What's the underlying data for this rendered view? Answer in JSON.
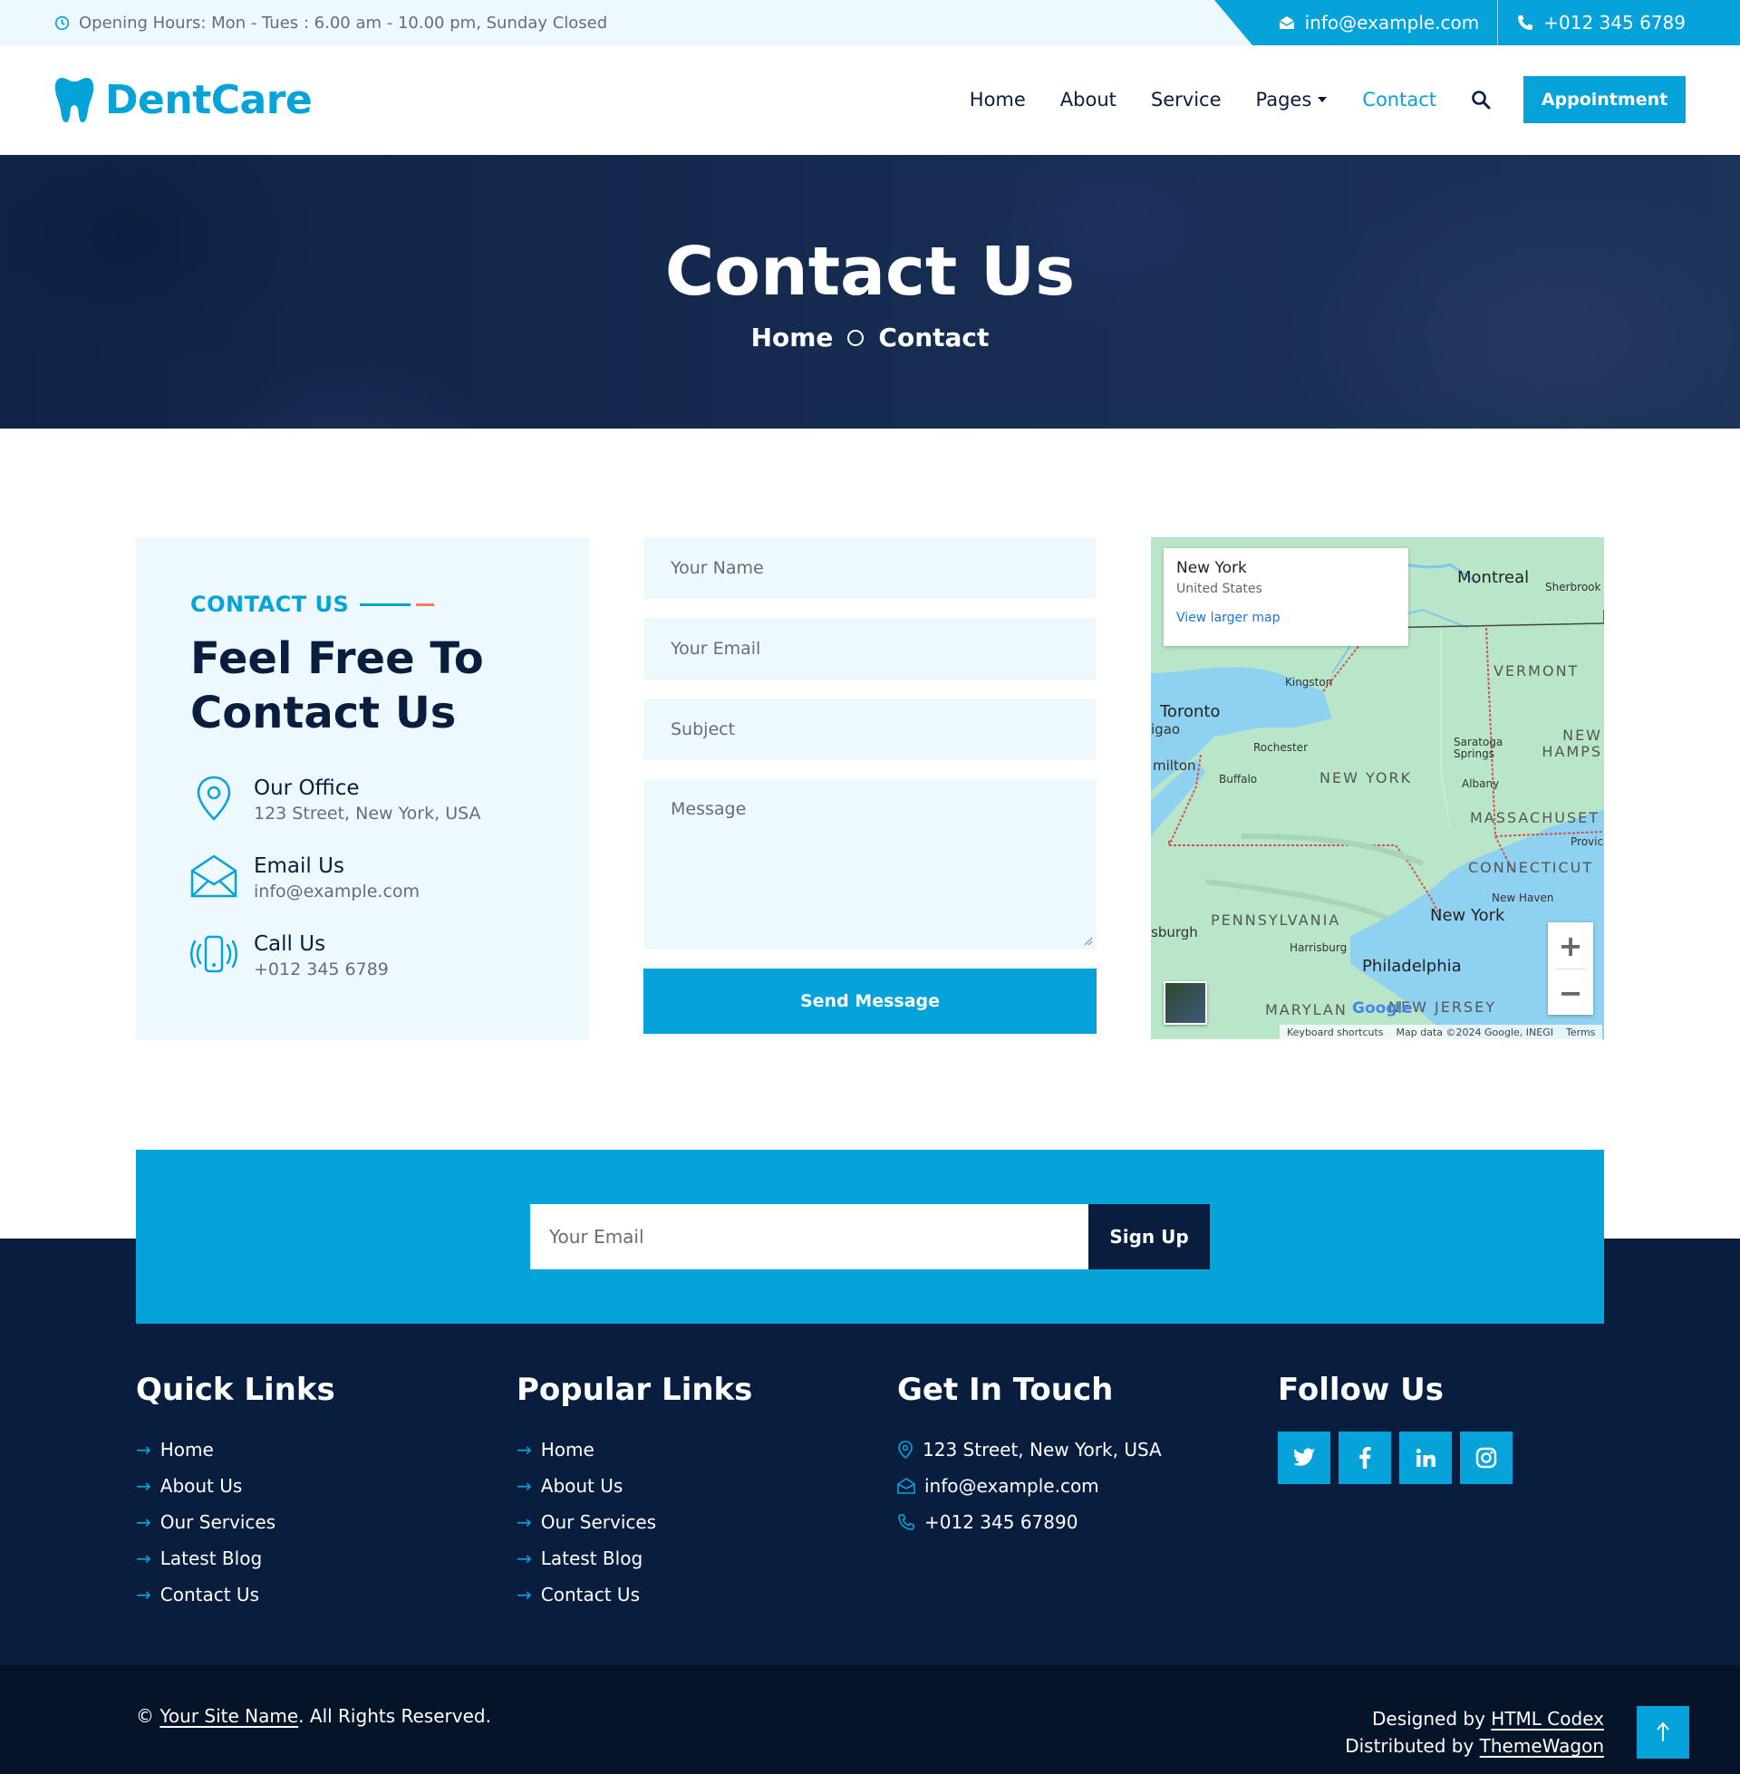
{
  "topbar": {
    "hours": "Opening Hours: Mon - Tues : 6.00 am - 10.00 pm, Sunday Closed",
    "email": "info@example.com",
    "phone": "+012 345 6789"
  },
  "brand": {
    "name": "DentCare"
  },
  "nav": {
    "items": [
      "Home",
      "About",
      "Service",
      "Pages",
      "Contact"
    ],
    "active": "Contact",
    "cta": "Appointment"
  },
  "hero": {
    "title": "Contact Us",
    "breadcrumb": [
      "Home",
      "Contact"
    ]
  },
  "contact": {
    "tag": "CONTACT US",
    "title": "Feel Free To Contact Us",
    "items": [
      {
        "icon": "map-pin-icon",
        "label": "Our Office",
        "value": "123 Street, New York, USA"
      },
      {
        "icon": "envelope-icon",
        "label": "Email Us",
        "value": "info@example.com"
      },
      {
        "icon": "phone-ring-icon",
        "label": "Call Us",
        "value": "+012 345 6789"
      }
    ]
  },
  "form": {
    "name_placeholder": "Your Name",
    "email_placeholder": "Your Email",
    "subject_placeholder": "Subject",
    "message_placeholder": "Message",
    "submit": "Send Message"
  },
  "map": {
    "place": "New York",
    "country": "United States",
    "link": "View larger map",
    "labels": {
      "montreal": "Montreal",
      "sherbrooke": "Sherbrook",
      "vermont": "VERMONT",
      "kingston": "Kingston",
      "toronto": "Toronto",
      "igao": "igao",
      "rochester": "Rochester",
      "milton": "milton",
      "buffalo": "Buffalo",
      "newyork_state": "NEW YORK",
      "saratoga": "Saratoga Springs",
      "new_hamps": "NEW HAMPS",
      "albany": "Albany",
      "massachusetts": "MASSACHUSET",
      "providence": "Provic",
      "connecticut": "CONNECTICUT",
      "new_haven": "New Haven",
      "pennsylvania": "PENNSYLVANIA",
      "new_york_city": "New York",
      "pittsburgh": "sburgh",
      "harrisburg": "Harrisburg",
      "philadelphia": "Philadelphia",
      "maryland": "MARYLAN",
      "new_jersey": "NEW JERSEY"
    },
    "attribution": [
      "Keyboard shortcuts",
      "Map data ©2024 Google, INEGI",
      "Terms"
    ],
    "google": "Google"
  },
  "newsletter": {
    "placeholder": "Your Email",
    "button": "Sign Up"
  },
  "footer": {
    "quick_links": {
      "title": "Quick Links",
      "items": [
        "Home",
        "About Us",
        "Our Services",
        "Latest Blog",
        "Contact Us"
      ]
    },
    "popular_links": {
      "title": "Popular Links",
      "items": [
        "Home",
        "About Us",
        "Our Services",
        "Latest Blog",
        "Contact Us"
      ]
    },
    "get_in_touch": {
      "title": "Get In Touch",
      "address": "123 Street, New York, USA",
      "email": "info@example.com",
      "phone": "+012 345 67890"
    },
    "follow_us": {
      "title": "Follow Us",
      "socials": [
        "twitter-icon",
        "facebook-icon",
        "linkedin-icon",
        "instagram-icon"
      ]
    }
  },
  "copyright": {
    "prefix": "©",
    "site": "Your Site Name",
    "suffix": ". All Rights Reserved.",
    "designed_prefix": "Designed by",
    "designed_by": "HTML Codex",
    "distributed_prefix": "Distributed by",
    "distributed_by": "ThemeWagon"
  },
  "colors": {
    "primary": "#06A3DA",
    "dark": "#091E3E",
    "light": "#EEF9FF",
    "accent": "#F57E57"
  }
}
